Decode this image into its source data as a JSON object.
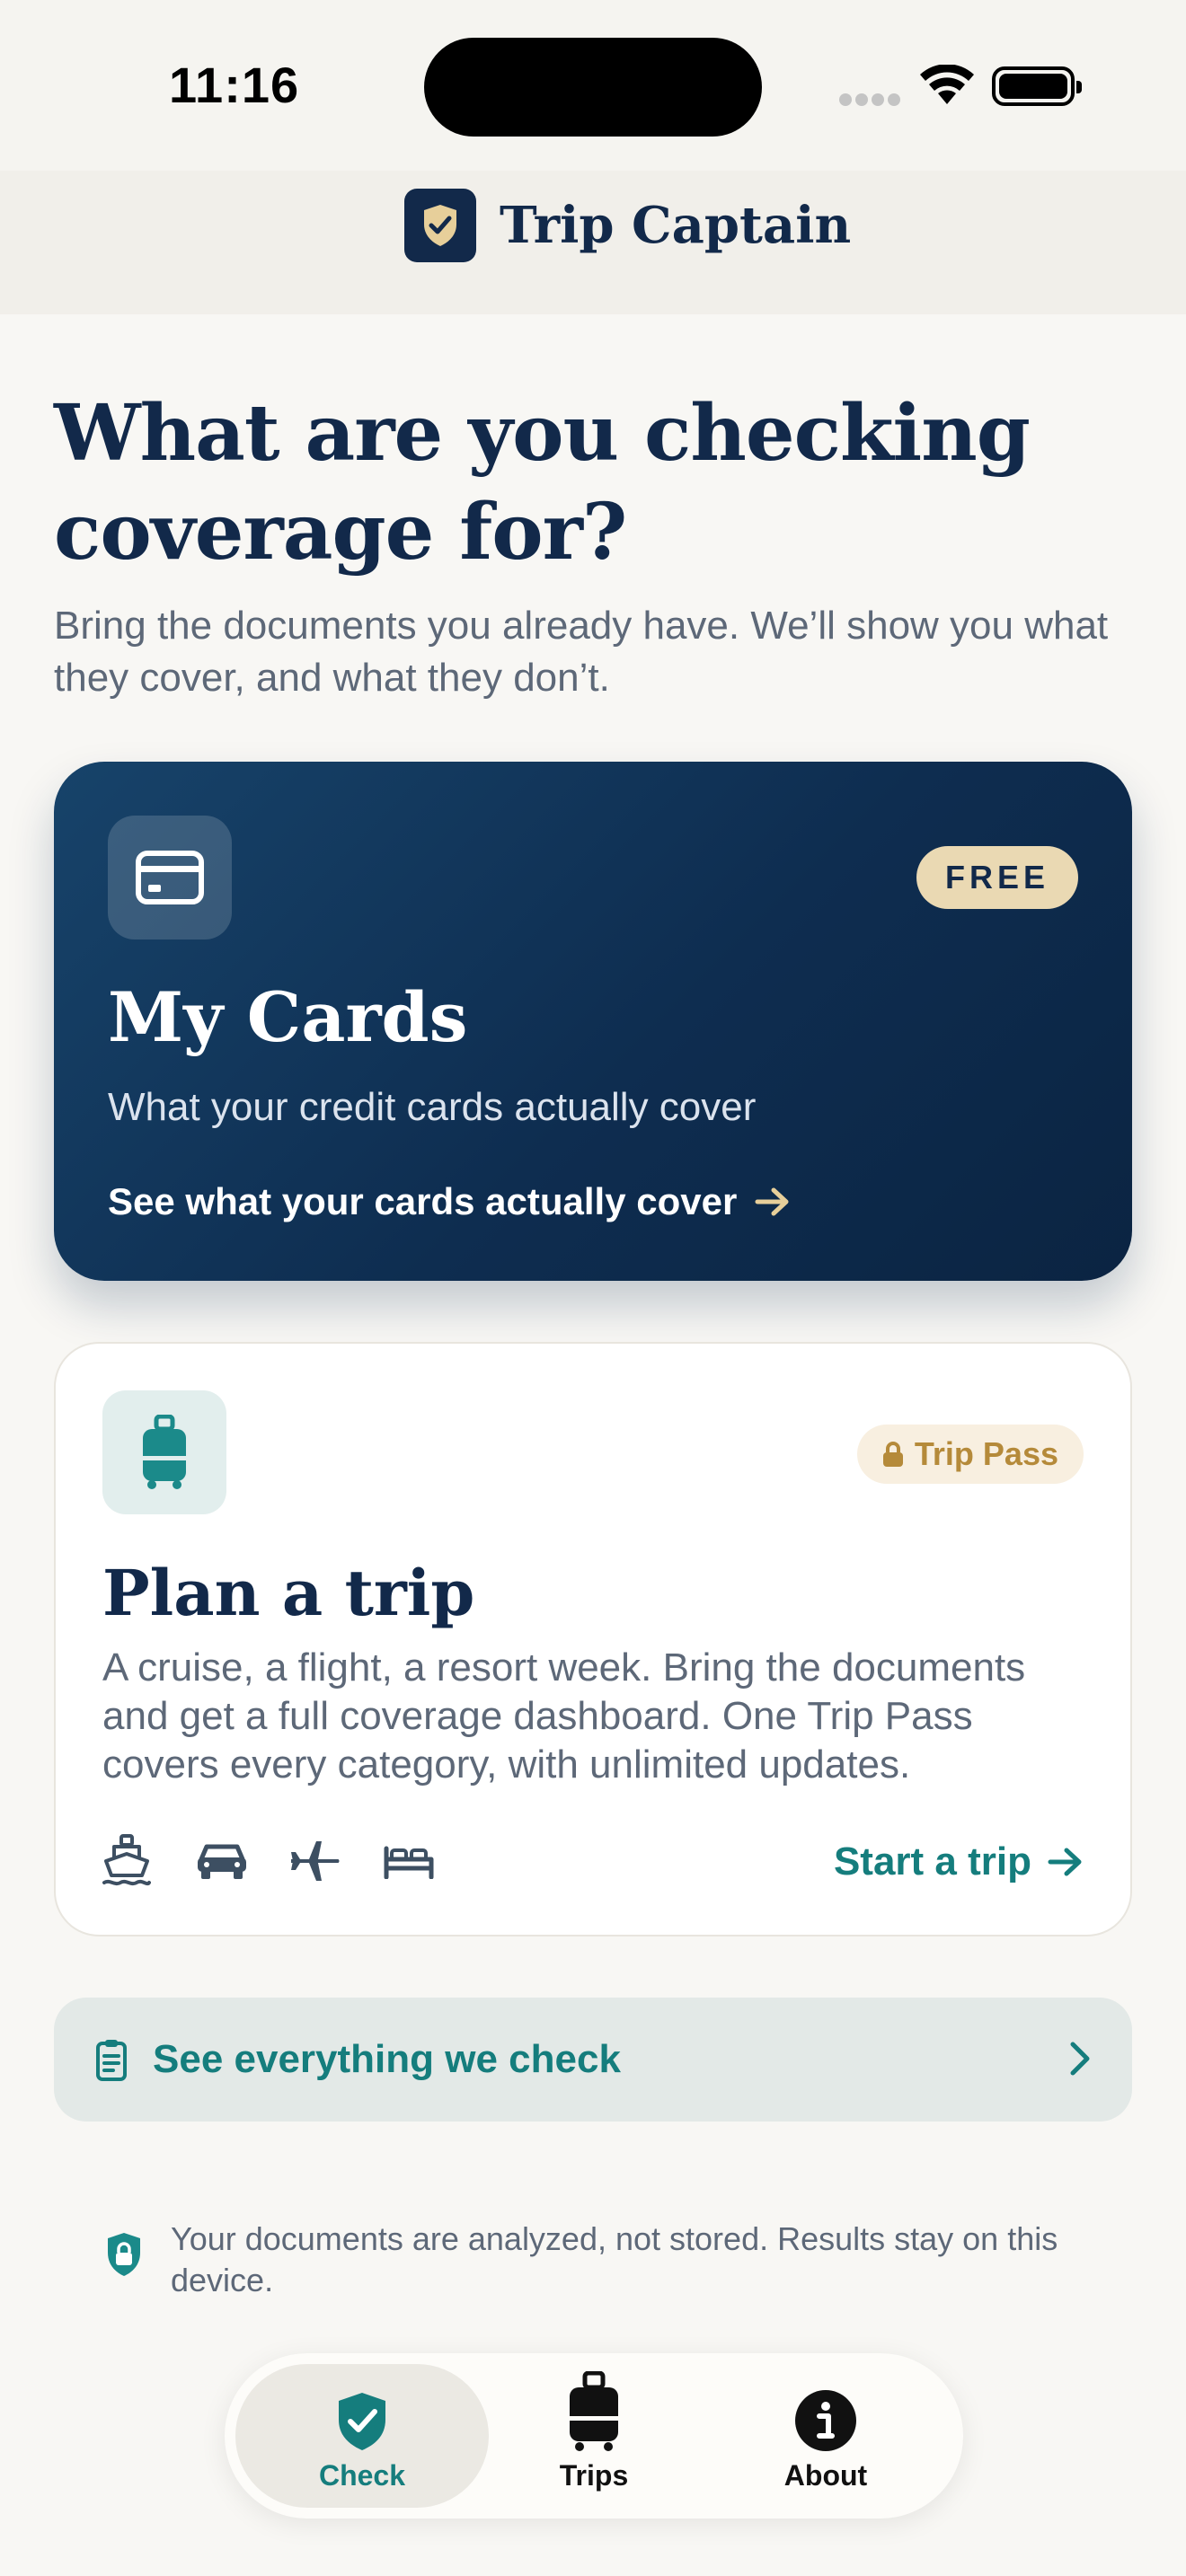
{
  "status_bar": {
    "time": "11:16"
  },
  "app": {
    "name": "Trip Captain"
  },
  "headline": "What are you checking coverage for?",
  "subhead": "Bring the documents you already have. We’ll show you what they cover, and what they don’t.",
  "my_cards": {
    "badge": "FREE",
    "title": "My Cards",
    "subtitle": "What your credit cards actually cover",
    "cta": "See what your cards actually cover"
  },
  "plan_trip": {
    "badge": "Trip Pass",
    "title": "Plan a trip",
    "description": "A cruise, a flight, a resort week. Bring the documents and get a full coverage dashboard. One Trip Pass covers every category, with unlimited updates.",
    "modes": [
      "cruise-icon",
      "car-icon",
      "airplane-icon",
      "bed-icon"
    ],
    "cta": "Start a trip"
  },
  "check_row": {
    "label": "See everything we check"
  },
  "privacy_note": "Your documents are analyzed, not stored. Results stay on this device.",
  "tabbar": {
    "tabs": [
      {
        "label": "Check",
        "icon": "shield-check-icon",
        "active": true
      },
      {
        "label": "Trips",
        "icon": "luggage-icon",
        "active": false
      },
      {
        "label": "About",
        "icon": "info-icon",
        "active": false
      }
    ]
  },
  "colors": {
    "navy": "#12294a",
    "teal": "#157d7d",
    "gold": "#b58a3a",
    "badge_cream": "#ead9b3",
    "background": "#f8f7f4"
  }
}
